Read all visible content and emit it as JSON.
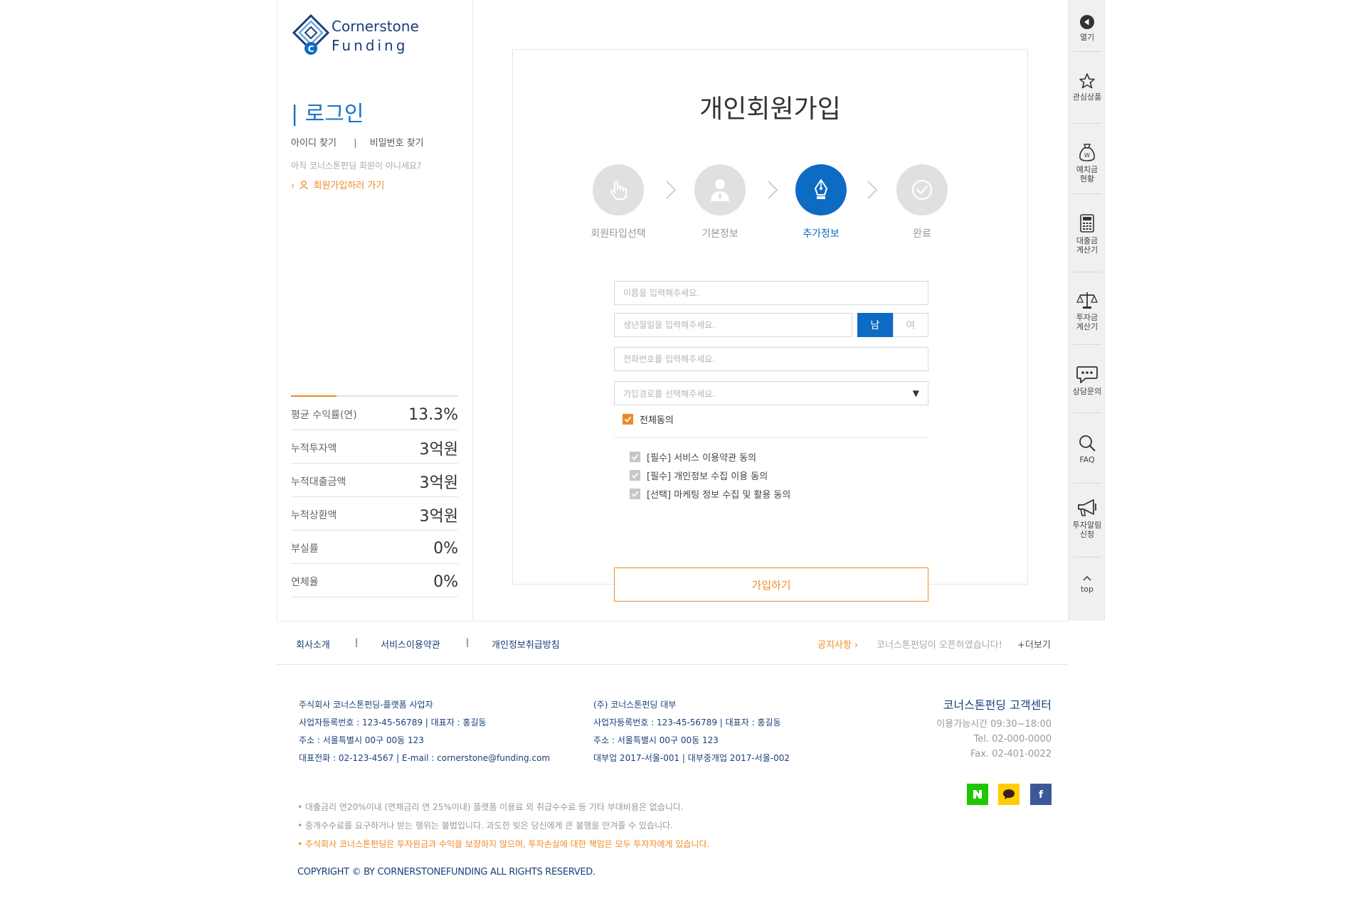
{
  "brand": {
    "logo_line1": "Cornerstone",
    "logo_line2": "Funding"
  },
  "sidebar": {
    "login_title": "| 로그인",
    "find_id": "아이디 찾기",
    "separator": "|",
    "find_password": "비밀번호 찾기",
    "not_member_text": "아직 코너스톤펀딩 회원이 아니세요?",
    "join_link": "회원가입하러 가기",
    "stats": [
      {
        "label": "평균 수익률(연)",
        "value": "13.3%"
      },
      {
        "label": "누적투자액",
        "value": "3억원"
      },
      {
        "label": "누적대출금액",
        "value": "3억원"
      },
      {
        "label": "누적상환액",
        "value": "3억원"
      },
      {
        "label": "부실률",
        "value": "0%"
      },
      {
        "label": "연체율",
        "value": "0%"
      }
    ]
  },
  "signup": {
    "title": "개인회원가입",
    "steps": [
      {
        "label": "회원타입선택",
        "active": false,
        "icon": "hand-pointer-icon"
      },
      {
        "label": "기본정보",
        "active": false,
        "icon": "user-icon"
      },
      {
        "label": "추가정보",
        "active": true,
        "icon": "pen-nib-icon"
      },
      {
        "label": "완료",
        "active": false,
        "icon": "check-circle-icon"
      }
    ],
    "name_placeholder": "이름을 입력해주세요.",
    "birth_placeholder": "생년월일을 입력해주세요.",
    "gender_male": "남",
    "gender_female": "여",
    "gender_selected": "남",
    "phone_placeholder": "전화번호를 입력해주세요.",
    "channel_placeholder": "가입경로를 선택해주세요.",
    "agree_all": "전체동의",
    "agreements": [
      "[필수] 서비스 이용약관 동의",
      "[필수] 개인정보 수집 이용 동의",
      "[선택] 마케팅 정보 수집 및 활용 동의"
    ],
    "submit": "가입하기"
  },
  "quick_menu": [
    {
      "label": "열기",
      "icon": "play-back-icon"
    },
    {
      "label": "관심상품",
      "icon": "star-icon"
    },
    {
      "label": "예치금\n현황",
      "icon": "money-bag-icon"
    },
    {
      "label": "대출금\n계산기",
      "icon": "calculator-icon"
    },
    {
      "label": "투자금\n계산기",
      "icon": "scale-icon"
    },
    {
      "label": "상담문의",
      "icon": "chat-bubble-icon"
    },
    {
      "label": "FAQ",
      "icon": "search-icon"
    },
    {
      "label": "투자알림\n신청",
      "icon": "megaphone-icon"
    },
    {
      "label": "top",
      "icon": "chevron-up-icon"
    }
  ],
  "footer": {
    "nav": [
      "회사소개",
      "서비스이용약관",
      "개인정보취급방침"
    ],
    "nav_sep": "|",
    "notice_label": "공지사항",
    "notice_text": "코너스톤펀딩이 오픈하였습니다!",
    "notice_more": "+더보기",
    "company1": [
      "주식회사 코너스톤펀딩-플랫폼 사업자",
      "사업자등록번호 : 123-45-56789 | 대표자 : 홍길동",
      "주소 : 서울특별시 00구 00동 123",
      "대표전화 : 02-123-4567 | E-mail : cornerstone@funding.com"
    ],
    "company2": [
      "(주) 코너스톤펀딩 대부",
      "사업자등록번호 : 123-45-56789 | 대표자 : 홍길동",
      "주소 : 서울특별시 00구 00동 123",
      "대부업 2017-서울-001 | 대부중개업 2017-서울-002"
    ],
    "cs_title": "코너스톤펀딩 고객센터",
    "cs_hours": "이용가능시간 09:30~18:00",
    "cs_tel": "Tel. 02-000-0000",
    "cs_fax": "Fax. 02-401-0022",
    "disclaimers": [
      "• 대출금리 연20%이내 (연체금리 연 25%이내) 플랫폼 이용료 외 취급수수료 등 기타 부대비용은 없습니다.",
      "• 중개수수료를 요구하거나 받는 행위는 불법입니다. 과도한 빚은 당신에게 큰 불행을 안겨줄 수 있습니다."
    ],
    "disclaimer_warning": "• 주식회사 코너스톤펀딩은 투자원금과 수익을 보장하지 않으며, 투자손실에 대한 책임은 모두 투자자에게 있습니다.",
    "copyright": "COPYRIGHT © BY CORNERSTONEFUNDING ALL RIGHTS RESERVED.",
    "sns": [
      {
        "label": "N",
        "color": "#1ec800",
        "icon": "naver-icon"
      },
      {
        "label": "",
        "color": "#ffcd00",
        "icon": "kakao-talk-icon"
      },
      {
        "label": "f",
        "color": "#3b5998",
        "icon": "facebook-icon"
      }
    ]
  },
  "colors": {
    "primary_blue": "#0e6bc4",
    "accent_orange": "#f08a24",
    "navy": "#1a3f7a"
  }
}
